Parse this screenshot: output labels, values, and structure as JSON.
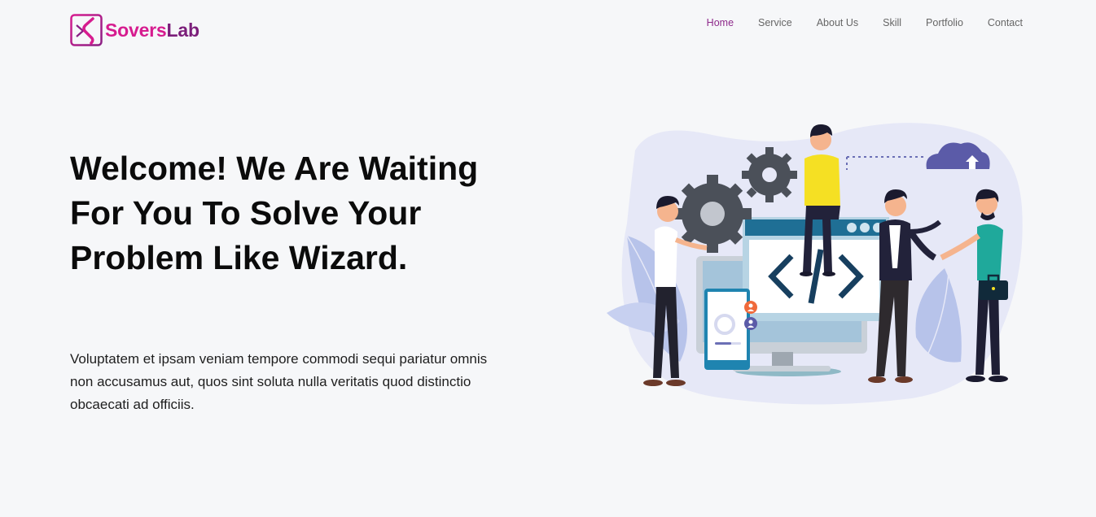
{
  "brand": {
    "name_part1": "Sovers",
    "name_part2": "Lab",
    "colors": {
      "primary": "#d61c8f",
      "secondary": "#7b1e7a",
      "active_nav": "#8e2a8b"
    }
  },
  "nav": {
    "items": [
      {
        "label": "Home",
        "active": true
      },
      {
        "label": "Service",
        "active": false
      },
      {
        "label": "About Us",
        "active": false
      },
      {
        "label": "Skill",
        "active": false
      },
      {
        "label": "Portfolio",
        "active": false
      },
      {
        "label": "Contact",
        "active": false
      }
    ]
  },
  "hero": {
    "title": "Welcome! We Are Waiting For You To Solve Your Problem Like Wizard.",
    "description": "Voluptatem et ipsam veniam tempore commodi sequi pariatur omnis non accusamus aut, quos sint soluta nulla veritatis quod distinctio obcaecati ad officiis."
  },
  "illustration": {
    "icons": [
      "gear-icon",
      "cloud-upload-icon",
      "code-icon",
      "user-icon",
      "briefcase-icon"
    ]
  }
}
